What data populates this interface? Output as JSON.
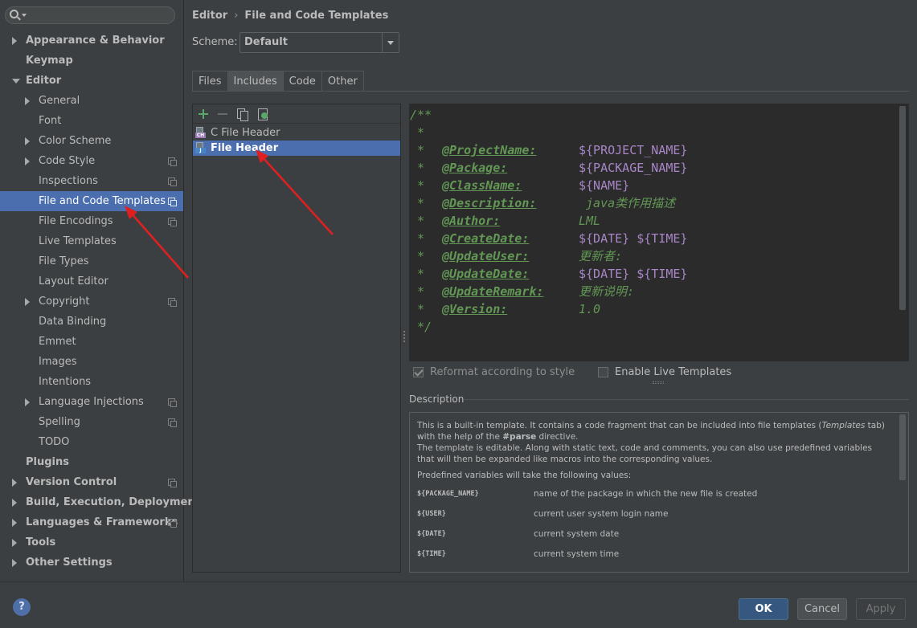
{
  "sidebar": {
    "search": {
      "placeholder": ""
    },
    "items": [
      {
        "label": "Appearance & Behavior",
        "level": 0,
        "arrow": "right",
        "bold": true,
        "proj": false
      },
      {
        "label": "Keymap",
        "level": 0,
        "arrow": "",
        "bold": true,
        "proj": false
      },
      {
        "label": "Editor",
        "level": 0,
        "arrow": "down",
        "bold": true,
        "proj": false
      },
      {
        "label": "General",
        "level": 1,
        "arrow": "right",
        "bold": false,
        "proj": false
      },
      {
        "label": "Font",
        "level": 1,
        "arrow": "",
        "bold": false,
        "proj": false
      },
      {
        "label": "Color Scheme",
        "level": 1,
        "arrow": "right",
        "bold": false,
        "proj": false
      },
      {
        "label": "Code Style",
        "level": 1,
        "arrow": "right",
        "bold": false,
        "proj": true
      },
      {
        "label": "Inspections",
        "level": 1,
        "arrow": "",
        "bold": false,
        "proj": true
      },
      {
        "label": "File and Code Templates",
        "level": 1,
        "arrow": "",
        "bold": false,
        "proj": true,
        "selected": true
      },
      {
        "label": "File Encodings",
        "level": 1,
        "arrow": "",
        "bold": false,
        "proj": true
      },
      {
        "label": "Live Templates",
        "level": 1,
        "arrow": "",
        "bold": false,
        "proj": false
      },
      {
        "label": "File Types",
        "level": 1,
        "arrow": "",
        "bold": false,
        "proj": false
      },
      {
        "label": "Layout Editor",
        "level": 1,
        "arrow": "",
        "bold": false,
        "proj": false
      },
      {
        "label": "Copyright",
        "level": 1,
        "arrow": "right",
        "bold": false,
        "proj": true
      },
      {
        "label": "Data Binding",
        "level": 1,
        "arrow": "",
        "bold": false,
        "proj": false
      },
      {
        "label": "Emmet",
        "level": 1,
        "arrow": "",
        "bold": false,
        "proj": false
      },
      {
        "label": "Images",
        "level": 1,
        "arrow": "",
        "bold": false,
        "proj": false
      },
      {
        "label": "Intentions",
        "level": 1,
        "arrow": "",
        "bold": false,
        "proj": false
      },
      {
        "label": "Language Injections",
        "level": 1,
        "arrow": "right",
        "bold": false,
        "proj": true
      },
      {
        "label": "Spelling",
        "level": 1,
        "arrow": "",
        "bold": false,
        "proj": true
      },
      {
        "label": "TODO",
        "level": 1,
        "arrow": "",
        "bold": false,
        "proj": false
      },
      {
        "label": "Plugins",
        "level": 0,
        "arrow": "",
        "bold": true,
        "proj": false
      },
      {
        "label": "Version Control",
        "level": 0,
        "arrow": "right",
        "bold": true,
        "proj": true
      },
      {
        "label": "Build, Execution, Deployment",
        "level": 0,
        "arrow": "right",
        "bold": true,
        "proj": false
      },
      {
        "label": "Languages & Frameworks",
        "level": 0,
        "arrow": "right",
        "bold": true,
        "proj": true
      },
      {
        "label": "Tools",
        "level": 0,
        "arrow": "right",
        "bold": true,
        "proj": false
      },
      {
        "label": "Other Settings",
        "level": 0,
        "arrow": "right",
        "bold": true,
        "proj": false
      }
    ]
  },
  "breadcrumb": {
    "parent": "Editor",
    "separator": "›",
    "current": "File and Code Templates"
  },
  "scheme": {
    "label": "Scheme:",
    "value": "Default"
  },
  "tabs": [
    {
      "label": "Files",
      "active": false
    },
    {
      "label": "Includes",
      "active": true
    },
    {
      "label": "Code",
      "active": false
    },
    {
      "label": "Other",
      "active": false
    }
  ],
  "templates": [
    {
      "label": "C File Header",
      "icon": "c-file-icon",
      "badge": "CH",
      "selected": false
    },
    {
      "label": "File Header",
      "icon": "java-file-icon",
      "badge": "J",
      "selected": true
    }
  ],
  "code": {
    "open": "/**",
    "blank_star": " *",
    "close": " */",
    "star": " *",
    "lines": [
      {
        "tag": "@ProjectName:",
        "value": "${PROJECT_NAME}",
        "doc": false
      },
      {
        "tag": "@Package:",
        "value": "${PACKAGE_NAME}",
        "doc": false
      },
      {
        "tag": "@ClassName:",
        "value": "${NAME}",
        "doc": false
      },
      {
        "tag": "@Description:",
        "value": " java类作用描述",
        "doc": true
      },
      {
        "tag": "@Author:",
        "value": "LML",
        "doc": true
      },
      {
        "tag": "@CreateDate:",
        "value": "${DATE} ${TIME}",
        "doc": false
      },
      {
        "tag": "@UpdateUser:",
        "value": "更新者:",
        "doc": true
      },
      {
        "tag": "@UpdateDate:",
        "value": "${DATE} ${TIME}",
        "doc": false
      },
      {
        "tag": "@UpdateRemark:",
        "value": "更新说明:",
        "doc": true
      },
      {
        "tag": "@Version:",
        "value": "1.0",
        "doc": true
      }
    ]
  },
  "options": {
    "reformat_label": "Reformat according to style",
    "reformat_checked": true,
    "live_label": "Enable Live Templates",
    "live_checked": false
  },
  "description": {
    "title": "Description",
    "para1": "This is a built-in template. It contains a code fragment that can be included into file templates (Templates tab) with the help of the #parse directive.",
    "para2": "The template is editable. Along with static text, code and comments, you can also use predefined variables that will then be expanded like macros into the corresponding values.",
    "para3": "Predefined variables will take the following values:",
    "vars": [
      {
        "name": "${PACKAGE_NAME}",
        "desc": "name of the package in which the new file is created"
      },
      {
        "name": "${USER}",
        "desc": "current user system login name"
      },
      {
        "name": "${DATE}",
        "desc": "current system date"
      },
      {
        "name": "${TIME}",
        "desc": "current system time"
      }
    ]
  },
  "buttons": {
    "help": "?",
    "ok": "OK",
    "cancel": "Cancel",
    "apply": "Apply"
  },
  "colors": {
    "accent": "#4b6eaf",
    "annotation": "#e02020",
    "doc_comment": "#629755",
    "template_var": "#a886c7"
  }
}
